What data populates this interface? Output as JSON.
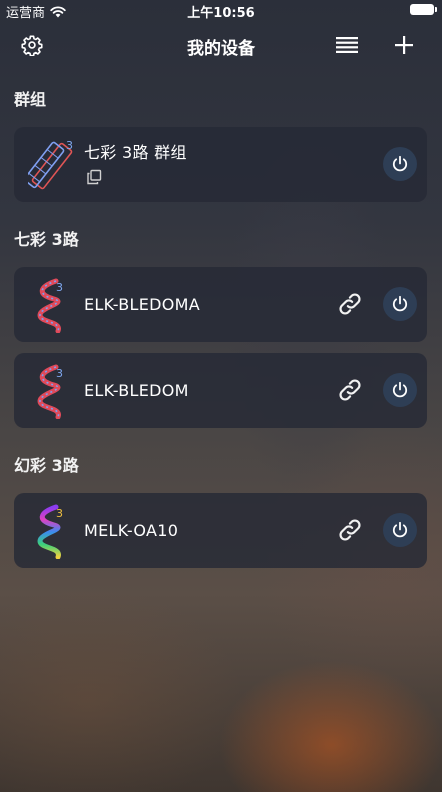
{
  "status_bar": {
    "carrier": "运营商",
    "time": "上午10:56"
  },
  "nav": {
    "title": "我的设备"
  },
  "sections": [
    {
      "title": "群组",
      "items": [
        {
          "name": "七彩 3路 群组",
          "badge": "3",
          "icon": "rgb-strip-group-icon"
        }
      ]
    },
    {
      "title": "七彩 3路",
      "items": [
        {
          "name": "ELK-BLEDOMA",
          "badge": "3",
          "icon": "rgb-strip-icon"
        },
        {
          "name": "ELK-BLEDOM",
          "badge": "3",
          "icon": "rgb-strip-icon"
        }
      ]
    },
    {
      "title": "幻彩 3路",
      "items": [
        {
          "name": "MELK-OA10",
          "badge": "3",
          "icon": "rainbow-strip-icon"
        }
      ]
    }
  ],
  "colors": {
    "card_bg": "#262a36",
    "power_bg": "#2e3e55",
    "badge_blue": "#7fa8f0",
    "badge_gold": "#f0c040"
  }
}
